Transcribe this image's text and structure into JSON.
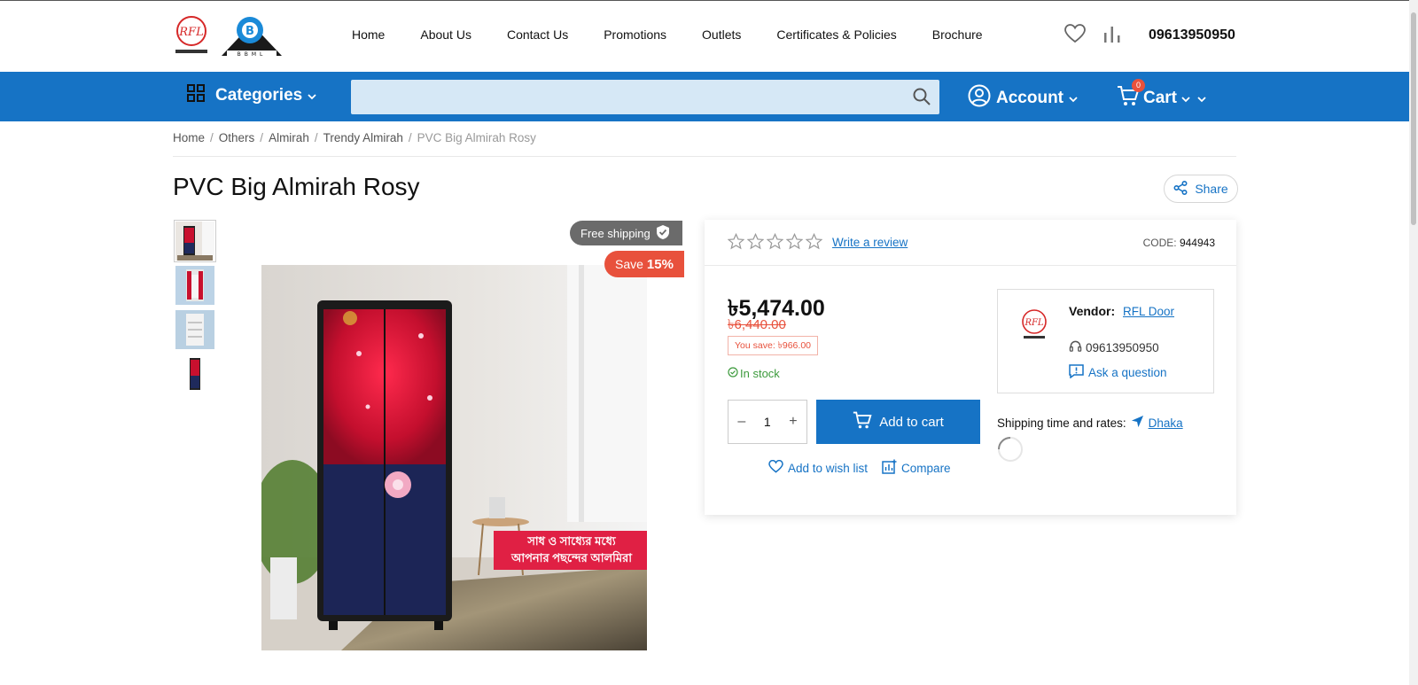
{
  "header": {
    "nav": [
      "Home",
      "About Us",
      "Contact Us",
      "Promotions",
      "Outlets",
      "Certificates & Policies",
      "Brochure"
    ],
    "phone": "09613950950"
  },
  "bar": {
    "categories": "Categories",
    "search_placeholder": "",
    "account": "Account",
    "cart": "Cart",
    "cart_count": "0"
  },
  "breadcrumb": [
    "Home",
    "Others",
    "Almirah",
    "Trendy Almirah",
    "PVC Big Almirah Rosy"
  ],
  "product": {
    "title": "PVC Big Almirah Rosy",
    "share": "Share",
    "free_shipping": "Free shipping",
    "save_label": "Save",
    "save_pct": "15%",
    "write_review": "Write a review",
    "code_label": "CODE:",
    "code": "944943",
    "price": "৳5,474.00",
    "old_price": "৳6,440.00",
    "you_save": "You save: ৳966.00",
    "stock": "In stock",
    "qty": "1",
    "add_to_cart": "Add to cart",
    "wishlist": "Add to wish list",
    "compare": "Compare",
    "rating": 0,
    "image_text_line1": "সাধ ও সাধ্যের মধ্যে",
    "image_text_line2": "আপনার পছন্দের আলমিরা"
  },
  "vendor": {
    "label": "Vendor:",
    "name": "RFL Door",
    "phone": "09613950950",
    "ask": "Ask a question"
  },
  "shipping": {
    "label": "Shipping time and rates:",
    "city": "Dhaka"
  },
  "colors": {
    "primary": "#1673c5",
    "sale": "#e8513c",
    "stock": "#3c9a3c"
  }
}
